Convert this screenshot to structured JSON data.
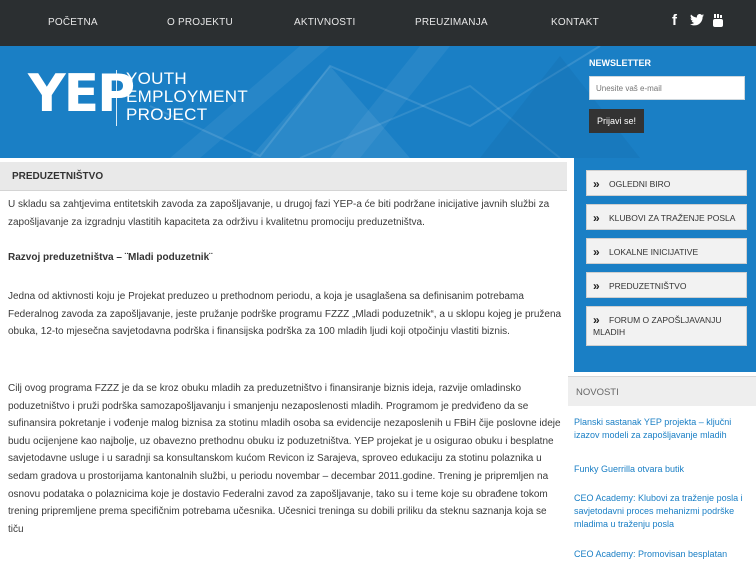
{
  "nav": {
    "items": [
      "POČETNA",
      "O PROJEKTU",
      "AKTIVNOSTI",
      "PREUZIMANJA",
      "KONTAKT"
    ],
    "social": [
      "f",
      "t",
      "y"
    ]
  },
  "banner": {
    "logo_mark": "YEP",
    "logo_lines": [
      "YOUTH",
      "EMPLOYMENT",
      "PROJECT"
    ],
    "newsletter_title": "NEWSLETTER",
    "newsletter_placeholder": "Unesite vaš e-mail",
    "newsletter_button": "Prijavi se!"
  },
  "main": {
    "section_title": "PREDUZETNIŠTVO",
    "paragraphs": [
      "U skladu sa zahtjevima entitetskih zavoda za zapošljavanje, u drugoj fazi YEP-a će biti podržane inicijative javnih službi za zapošljavanje za izgradnju vlastitih kapaciteta za održivu i kvalitetnu promociju preduzetništva.",
      "Razvoj preduzetništva – ¨Mladi poduzetnik¨",
      "Jedna od aktivnosti koju je Projekat preduzeo u prethodnom periodu, a koja je usaglašena sa definisanim potrebama Federalnog zavoda za zapošljavanje, jeste pružanje podrške programu FZZZ „Mladi poduzetnik“, a u sklopu kojeg je pružena obuka, 12-to mjesečna savjetodavna podrška i finansijska podrška za 100 mladih ljudi koji otpočinju vlastiti biznis.",
      "Cilj ovog programa FZZZ je da se kroz obuku mladih za preduzetništvo i finansiranje biznis ideja, razvije omladinsko poduzetništvo i pruži podrška samozapošljavanju i smanjenju nezaposlenosti mladih. Programom je predviđeno da se sufinansira pokretanje i vođenje malog biznisa za stotinu mladih osoba sa evidencije nezaposlenih u FBiH čije poslovne ideje budu ocijenjene kao najbolje, uz obavezno prethodnu obuku iz poduzetništva. YEP projekat je u osigurao obuku i besplatne savjetodavne usluge i u saradnji sa konsultanskom kućom Revicon iz Sarajeva, sproveo edukaciju za stotinu polaznika u sedam gradova u prostorijama kantonalnih službi, u periodu novembar – decembar 2011.godine. Trening je pripremljen na osnovu podataka o polaznicima koje je dostavio Federalni zavod za zapošljavanje, tako su i teme koje su obrađene tokom trening pripremljene prema specifičnim potrebama učesnika. Učesnici treninga su dobili priliku da steknu saznanja koja se tiču"
    ]
  },
  "sidebar": {
    "items": [
      "OGLEDNI BIRO",
      "KLUBOVI ZA TRAŽENJE POSLA",
      "LOKALNE INICIJATIVE",
      "PREDUZETNIŠTVO",
      "FORUM O ZAPOŠLJAVANJU MLADIH"
    ],
    "novosti_title": "NOVOSTI",
    "news": [
      "Planski sastanak YEP projekta – ključni izazov modeli za zapošljavanje mladih",
      "Funky Guerrilla otvara butik",
      "CEO Academy: Klubovi za traženje posla i savjetodavni proces mehanizmi podrške mladima u traženju posla",
      "CEO Academy: Promovisan besplatan"
    ]
  },
  "colors": {
    "nav_bg": "#2b2f31",
    "brand_blue": "#1a7fc5",
    "link_blue": "#1a7fc5"
  }
}
